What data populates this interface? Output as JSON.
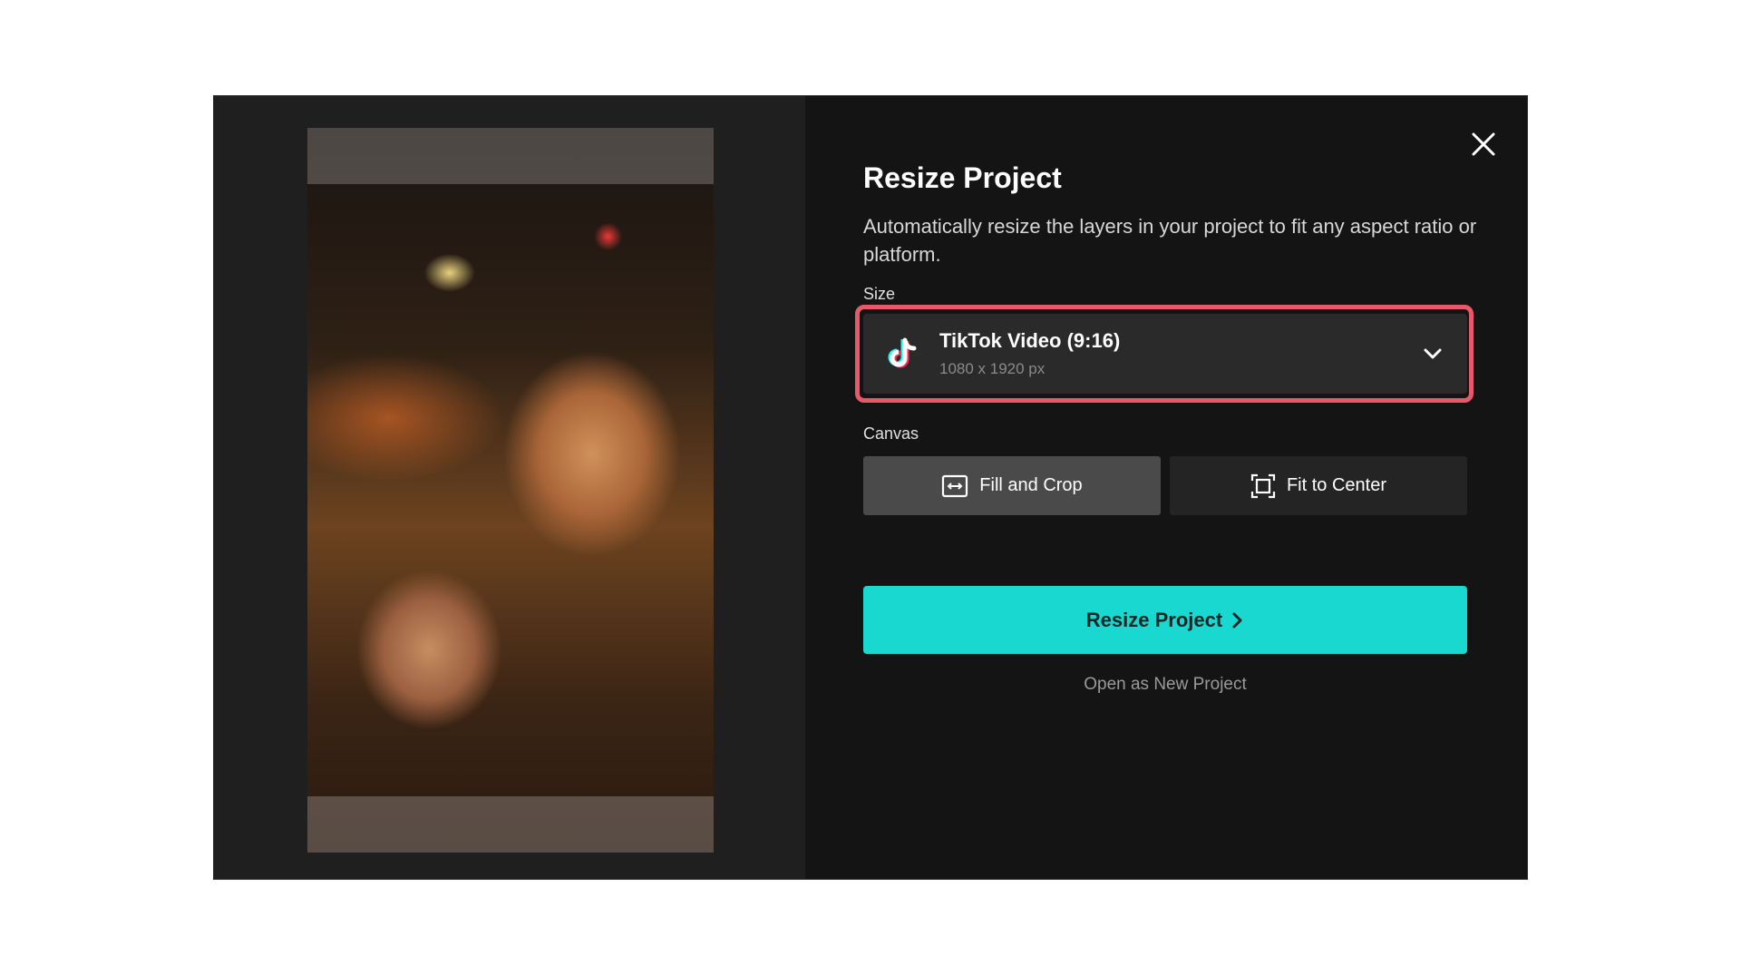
{
  "dialog": {
    "title": "Resize Project",
    "description": "Automatically resize the layers in your project to fit any aspect ratio or platform.",
    "close_icon": "close-icon"
  },
  "size": {
    "label": "Size",
    "selected_name": "TikTok Video (9:16)",
    "selected_dims": "1080 x 1920 px",
    "icon": "tiktok-icon",
    "highlight_color": "#e8586b"
  },
  "canvas": {
    "label": "Canvas",
    "options": [
      {
        "label": "Fill and Crop",
        "icon": "fill-crop-icon",
        "active": true
      },
      {
        "label": "Fit to Center",
        "icon": "fit-center-icon",
        "active": false
      }
    ]
  },
  "actions": {
    "primary_label": "Resize Project",
    "primary_color": "#18d8d0",
    "secondary_label": "Open as New Project"
  }
}
